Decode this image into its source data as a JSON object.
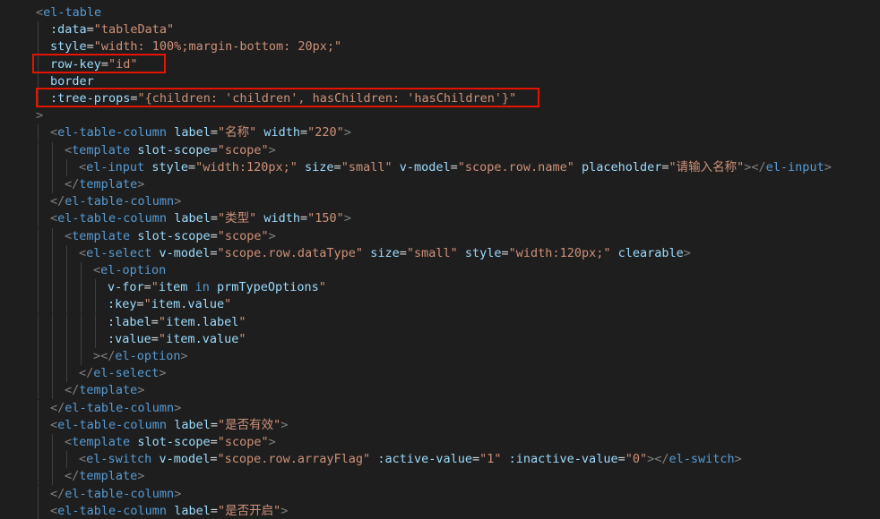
{
  "code": {
    "lines": [
      {
        "indent": 1,
        "tokens": [
          [
            "punct",
            "<"
          ],
          [
            "tag",
            "el-table"
          ]
        ]
      },
      {
        "indent": 2,
        "tokens": [
          [
            "attr",
            ":data"
          ],
          [
            "text",
            "="
          ],
          [
            "str",
            "\"tableData\""
          ]
        ]
      },
      {
        "indent": 2,
        "tokens": [
          [
            "attr",
            "style"
          ],
          [
            "text",
            "="
          ],
          [
            "str",
            "\"width: 100%;margin-bottom: 20px;\""
          ]
        ]
      },
      {
        "indent": 2,
        "tokens": [
          [
            "attr",
            "row-key"
          ],
          [
            "text",
            "="
          ],
          [
            "str",
            "\"id\""
          ]
        ]
      },
      {
        "indent": 2,
        "tokens": [
          [
            "attr",
            "border"
          ]
        ]
      },
      {
        "indent": 2,
        "tokens": [
          [
            "attr",
            ":tree-props"
          ],
          [
            "text",
            "="
          ],
          [
            "str",
            "\"{children: "
          ],
          [
            "str",
            "'children'"
          ],
          [
            "str",
            ", hasChildren: "
          ],
          [
            "str",
            "'hasChildren'"
          ],
          [
            "str",
            "}\""
          ]
        ]
      },
      {
        "indent": 1,
        "tokens": [
          [
            "punct",
            ">"
          ]
        ]
      },
      {
        "indent": 2,
        "tokens": [
          [
            "punct",
            "<"
          ],
          [
            "tag",
            "el-table-column"
          ],
          [
            "text",
            " "
          ],
          [
            "attr",
            "label"
          ],
          [
            "text",
            "="
          ],
          [
            "str",
            "\"名称\""
          ],
          [
            "text",
            " "
          ],
          [
            "attr",
            "width"
          ],
          [
            "text",
            "="
          ],
          [
            "str",
            "\"220\""
          ],
          [
            "punct",
            ">"
          ]
        ]
      },
      {
        "indent": 3,
        "tokens": [
          [
            "punct",
            "<"
          ],
          [
            "tag",
            "template"
          ],
          [
            "text",
            " "
          ],
          [
            "attr",
            "slot-scope"
          ],
          [
            "text",
            "="
          ],
          [
            "str",
            "\"scope\""
          ],
          [
            "punct",
            ">"
          ]
        ]
      },
      {
        "indent": 4,
        "tokens": [
          [
            "punct",
            "<"
          ],
          [
            "tag",
            "el-input"
          ],
          [
            "text",
            " "
          ],
          [
            "attr",
            "style"
          ],
          [
            "text",
            "="
          ],
          [
            "str",
            "\"width:120px;\""
          ],
          [
            "text",
            " "
          ],
          [
            "attr",
            "size"
          ],
          [
            "text",
            "="
          ],
          [
            "str",
            "\"small\""
          ],
          [
            "text",
            " "
          ],
          [
            "attr",
            "v-model"
          ],
          [
            "text",
            "="
          ],
          [
            "str",
            "\"scope.row.name\""
          ],
          [
            "text",
            " "
          ],
          [
            "attr",
            "placeholder"
          ],
          [
            "text",
            "="
          ],
          [
            "str",
            "\"请输入名称\""
          ],
          [
            "punct",
            "></"
          ],
          [
            "tag",
            "el-input"
          ],
          [
            "punct",
            ">"
          ]
        ]
      },
      {
        "indent": 3,
        "tokens": [
          [
            "punct",
            "</"
          ],
          [
            "tag",
            "template"
          ],
          [
            "punct",
            ">"
          ]
        ]
      },
      {
        "indent": 2,
        "tokens": [
          [
            "punct",
            "</"
          ],
          [
            "tag",
            "el-table-column"
          ],
          [
            "punct",
            ">"
          ]
        ]
      },
      {
        "indent": 2,
        "tokens": [
          [
            "punct",
            "<"
          ],
          [
            "tag",
            "el-table-column"
          ],
          [
            "text",
            " "
          ],
          [
            "attr",
            "label"
          ],
          [
            "text",
            "="
          ],
          [
            "str",
            "\"类型\""
          ],
          [
            "text",
            " "
          ],
          [
            "attr",
            "width"
          ],
          [
            "text",
            "="
          ],
          [
            "str",
            "\"150\""
          ],
          [
            "punct",
            ">"
          ]
        ]
      },
      {
        "indent": 3,
        "tokens": [
          [
            "punct",
            "<"
          ],
          [
            "tag",
            "template"
          ],
          [
            "text",
            " "
          ],
          [
            "attr",
            "slot-scope"
          ],
          [
            "text",
            "="
          ],
          [
            "str",
            "\"scope\""
          ],
          [
            "punct",
            ">"
          ]
        ]
      },
      {
        "indent": 4,
        "tokens": [
          [
            "punct",
            "<"
          ],
          [
            "tag",
            "el-select"
          ],
          [
            "text",
            " "
          ],
          [
            "attr",
            "v-model"
          ],
          [
            "text",
            "="
          ],
          [
            "str",
            "\"scope.row.dataType\""
          ],
          [
            "text",
            " "
          ],
          [
            "attr",
            "size"
          ],
          [
            "text",
            "="
          ],
          [
            "str",
            "\"small\""
          ],
          [
            "text",
            " "
          ],
          [
            "attr",
            "style"
          ],
          [
            "text",
            "="
          ],
          [
            "str",
            "\"width:120px;\""
          ],
          [
            "text",
            " "
          ],
          [
            "attr",
            "clearable"
          ],
          [
            "punct",
            ">"
          ]
        ]
      },
      {
        "indent": 5,
        "tokens": [
          [
            "punct",
            "<"
          ],
          [
            "tag",
            "el-option"
          ]
        ]
      },
      {
        "indent": 6,
        "tokens": [
          [
            "attr",
            "v-for"
          ],
          [
            "text",
            "="
          ],
          [
            "str",
            "\""
          ],
          [
            "attr",
            "item"
          ],
          [
            "text",
            " "
          ],
          [
            "kw",
            "in"
          ],
          [
            "text",
            " "
          ],
          [
            "attr",
            "prmTypeOptions"
          ],
          [
            "str",
            "\""
          ]
        ]
      },
      {
        "indent": 6,
        "tokens": [
          [
            "attr",
            ":key"
          ],
          [
            "text",
            "="
          ],
          [
            "str",
            "\""
          ],
          [
            "attr",
            "item.value"
          ],
          [
            "str",
            "\""
          ]
        ]
      },
      {
        "indent": 6,
        "tokens": [
          [
            "attr",
            ":label"
          ],
          [
            "text",
            "="
          ],
          [
            "str",
            "\""
          ],
          [
            "attr",
            "item.label"
          ],
          [
            "str",
            "\""
          ]
        ]
      },
      {
        "indent": 6,
        "tokens": [
          [
            "attr",
            ":value"
          ],
          [
            "text",
            "="
          ],
          [
            "str",
            "\""
          ],
          [
            "attr",
            "item.value"
          ],
          [
            "str",
            "\""
          ]
        ]
      },
      {
        "indent": 5,
        "tokens": [
          [
            "punct",
            "></"
          ],
          [
            "tag",
            "el-option"
          ],
          [
            "punct",
            ">"
          ]
        ]
      },
      {
        "indent": 4,
        "tokens": [
          [
            "punct",
            "</"
          ],
          [
            "tag",
            "el-select"
          ],
          [
            "punct",
            ">"
          ]
        ]
      },
      {
        "indent": 3,
        "tokens": [
          [
            "punct",
            "</"
          ],
          [
            "tag",
            "template"
          ],
          [
            "punct",
            ">"
          ]
        ]
      },
      {
        "indent": 2,
        "tokens": [
          [
            "punct",
            "</"
          ],
          [
            "tag",
            "el-table-column"
          ],
          [
            "punct",
            ">"
          ]
        ]
      },
      {
        "indent": 2,
        "tokens": [
          [
            "punct",
            "<"
          ],
          [
            "tag",
            "el-table-column"
          ],
          [
            "text",
            " "
          ],
          [
            "attr",
            "label"
          ],
          [
            "text",
            "="
          ],
          [
            "str",
            "\"是否有效\""
          ],
          [
            "punct",
            ">"
          ]
        ]
      },
      {
        "indent": 3,
        "tokens": [
          [
            "punct",
            "<"
          ],
          [
            "tag",
            "template"
          ],
          [
            "text",
            " "
          ],
          [
            "attr",
            "slot-scope"
          ],
          [
            "text",
            "="
          ],
          [
            "str",
            "\"scope\""
          ],
          [
            "punct",
            ">"
          ]
        ]
      },
      {
        "indent": 4,
        "tokens": [
          [
            "punct",
            "<"
          ],
          [
            "tag",
            "el-switch"
          ],
          [
            "text",
            " "
          ],
          [
            "attr",
            "v-model"
          ],
          [
            "text",
            "="
          ],
          [
            "str",
            "\"scope.row.arrayFlag\""
          ],
          [
            "text",
            " "
          ],
          [
            "attr",
            ":active-value"
          ],
          [
            "text",
            "="
          ],
          [
            "str",
            "\"1\""
          ],
          [
            "text",
            " "
          ],
          [
            "attr",
            ":inactive-value"
          ],
          [
            "text",
            "="
          ],
          [
            "str",
            "\"0\""
          ],
          [
            "punct",
            "></"
          ],
          [
            "tag",
            "el-switch"
          ],
          [
            "punct",
            ">"
          ]
        ]
      },
      {
        "indent": 3,
        "tokens": [
          [
            "punct",
            "</"
          ],
          [
            "tag",
            "template"
          ],
          [
            "punct",
            ">"
          ]
        ]
      },
      {
        "indent": 2,
        "tokens": [
          [
            "punct",
            "</"
          ],
          [
            "tag",
            "el-table-column"
          ],
          [
            "punct",
            ">"
          ]
        ]
      },
      {
        "indent": 2,
        "tokens": [
          [
            "punct",
            "<"
          ],
          [
            "tag",
            "el-table-column"
          ],
          [
            "text",
            " "
          ],
          [
            "attr",
            "label"
          ],
          [
            "text",
            "="
          ],
          [
            "str",
            "\"是否开启\""
          ],
          [
            "punct",
            ">"
          ]
        ]
      }
    ]
  },
  "highlights": [
    {
      "line": 3,
      "label": "row-key"
    },
    {
      "line": 5,
      "label": "tree-props"
    }
  ],
  "colors": {
    "background": "#1e1e1e",
    "tag": "#569cd6",
    "attribute": "#9cdcfe",
    "string": "#ce9178",
    "punctuation": "#808080",
    "highlight_border": "#e51400"
  }
}
